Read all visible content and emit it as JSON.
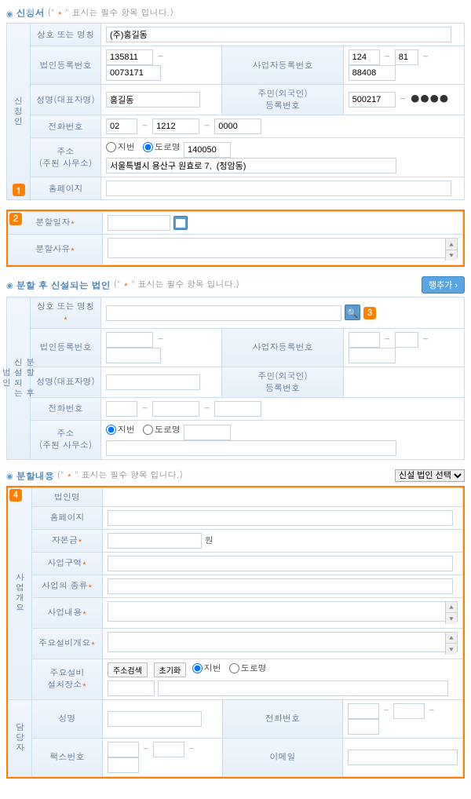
{
  "common": {
    "req_note": "표시는 필수 항목 입니다.",
    "req_paren_open": "(\"",
    "req_paren_close": "\"",
    "star": "*",
    "sep": "-"
  },
  "sec1": {
    "title": "신청서",
    "side": "신청인",
    "badge": "1",
    "labels": {
      "company": "상호 또는 명칭",
      "corp_reg": "법인등록번호",
      "biz_reg": "사업자등록번호",
      "rep_name": "성명(대표자명)",
      "resident": "주민(외국인)\n등록번호",
      "phone": "전화번호",
      "addr": "주소\n(주된 사무소)",
      "homepage": "홈페이지",
      "jibun": "지번",
      "doro": "도로명"
    },
    "values": {
      "company": "(주)홍길동",
      "corp_reg1": "135811",
      "corp_reg2": "0073171",
      "biz1": "124",
      "biz2": "81",
      "biz3": "88408",
      "rep_name": "홍길동",
      "res1": "500217",
      "ph1": "02",
      "ph2": "1212",
      "ph3": "0000",
      "zip": "140050",
      "addr": "서울특별시 용산구 원효로 7,  (청암동)"
    }
  },
  "sec2": {
    "badge": "2",
    "labels": {
      "split_date": "분할일자",
      "split_reason": "분할사유"
    }
  },
  "sec3": {
    "title": "분할 후 신설되는 법인",
    "add_btn": "행추가 ›",
    "side": "분할 후\n신설되는\n법인",
    "badge": "3",
    "labels": {
      "company": "상호 또는 명칭",
      "corp_reg": "법인등록번호",
      "biz_reg": "사업자등록번호",
      "rep_name": "성명(대표자명)",
      "resident": "주민(외국인)\n등록번호",
      "phone": "전화번호",
      "addr": "주소\n(주된 사무소)",
      "jibun": "지번",
      "doro": "도로명"
    }
  },
  "sec4": {
    "title": "분할내용",
    "dropdown": "신설 법인 선택",
    "side1": "사업개요",
    "side2": "담당자",
    "badge": "4",
    "labels": {
      "corp_name": "법인명",
      "homepage": "홈페이지",
      "capital": "자본금",
      "won": "원",
      "biz_area": "사업구역",
      "biz_type": "사업의 종류",
      "biz_content": "사업내용",
      "main_equip_overview": "주요설비개요",
      "main_equip_loc": "주요설비\n설치장소",
      "addr_search": "주소검색",
      "reset": "초기화",
      "jibun": "지번",
      "doro": "도로명",
      "name": "성명",
      "phone": "전화번호",
      "fax": "팩스번호",
      "email": "이메일"
    }
  }
}
